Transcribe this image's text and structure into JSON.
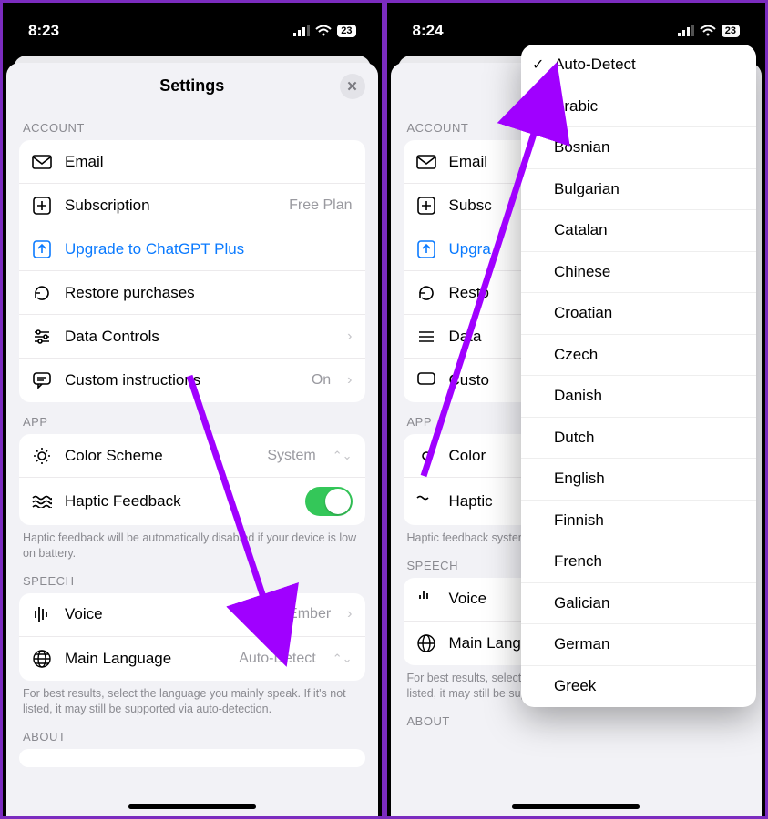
{
  "status": {
    "time_left": "8:23",
    "time_right": "8:24",
    "battery": "23"
  },
  "header": {
    "title": "Settings"
  },
  "sections": {
    "account": {
      "label": "ACCOUNT",
      "email": "Email",
      "subscription": "Subscription",
      "subscription_value": "Free Plan",
      "upgrade": "Upgrade to ChatGPT Plus",
      "restore": "Restore purchases",
      "data_controls": "Data Controls",
      "custom_instructions": "Custom instructions",
      "custom_instructions_value": "On"
    },
    "app": {
      "label": "APP",
      "color_scheme": "Color Scheme",
      "color_scheme_value": "System",
      "haptic": "Haptic Feedback",
      "haptic_footer": "Haptic feedback will be automatically disabled if your device is low on battery."
    },
    "speech": {
      "label": "SPEECH",
      "voice": "Voice",
      "voice_value": "Ember",
      "main_language": "Main Language",
      "main_language_value": "Auto-Detect",
      "footer": "For best results, select the language you mainly speak. If it's not listed, it may still be supported via auto-detection."
    },
    "about": {
      "label": "ABOUT"
    }
  },
  "lang_menu": {
    "auto": "Auto-Detect",
    "items": [
      "Arabic",
      "Bosnian",
      "Bulgarian",
      "Catalan",
      "Chinese",
      "Croatian",
      "Czech",
      "Danish",
      "Dutch",
      "English",
      "Finnish",
      "French",
      "Galician",
      "German",
      "Greek"
    ]
  },
  "right_trunc": {
    "email": "Email",
    "subscription": "Subsc",
    "upgrade": "Upgra",
    "restore": "Resto",
    "data_controls": "Data",
    "custom_instructions": "Custo",
    "color_scheme": "Color",
    "haptic": "Haptic",
    "haptic_footer": "Haptic feedback\nsystem is low",
    "voice": "Voice",
    "main_language": "Main Language"
  }
}
